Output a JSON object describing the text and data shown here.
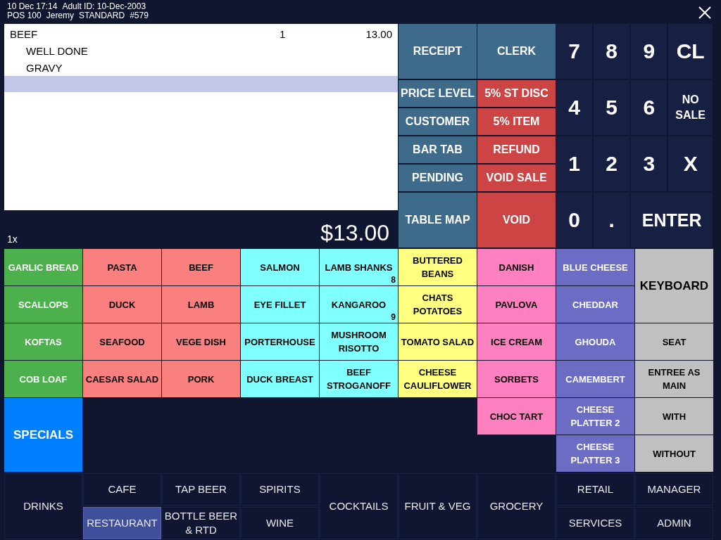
{
  "header": {
    "line_1": [
      "10 Dec 17:14",
      "Adult ID: 10-Dec-2003"
    ],
    "line_2": [
      "POS 100",
      "Jeremy",
      "STANDARD",
      "#579"
    ]
  },
  "order": {
    "lines": [
      {
        "name": "BEEF",
        "qty": "1",
        "price": "13.00",
        "children": [
          {
            "name": "WELL DONE"
          },
          {
            "name": "GRAVY"
          }
        ]
      }
    ],
    "input_line": {
      "selected": true
    },
    "quantity": "1x",
    "total": "$13.00"
  },
  "functions": [
    [
      {
        "label": "RECEIPT",
        "color": "#3f6b8a"
      },
      {
        "label": "CLERK",
        "color": "#3f6b8a"
      }
    ],
    [
      {
        "label": "PRICE LEVEL",
        "color": "#3f6b8a"
      },
      {
        "label": "5% ST DISC",
        "color": "#cc4444"
      }
    ],
    [
      {
        "label": "CUSTOMER",
        "color": "#3f6b8a"
      },
      {
        "label": "5% ITEM",
        "color": "#cc4444"
      }
    ],
    [
      {
        "label": "BAR TAB",
        "color": "#3f6b8a"
      },
      {
        "label": "REFUND",
        "color": "#cc4444"
      }
    ],
    [
      {
        "label": "PENDING",
        "color": "#3f6b8a"
      },
      {
        "label": "VOID SALE",
        "color": "#cc4444"
      }
    ],
    [
      {
        "label": "TABLE MAP",
        "color": "#3f6b8a"
      },
      {
        "label": "VOID",
        "color": "#cc4444"
      }
    ]
  ],
  "keypad": [
    {
      "label": "7",
      "kind": "key"
    },
    {
      "label": "8",
      "kind": "key"
    },
    {
      "label": "9",
      "kind": "key"
    },
    {
      "label": "CL",
      "kind": "key"
    },
    {
      "label": "4",
      "kind": "key"
    },
    {
      "label": "5",
      "kind": "key"
    },
    {
      "label": "6",
      "kind": "key"
    },
    {
      "label": "NO SALE",
      "kind": "small"
    },
    {
      "label": "1",
      "kind": "key"
    },
    {
      "label": "2",
      "kind": "key"
    },
    {
      "label": "3",
      "kind": "key"
    },
    {
      "label": "X",
      "kind": "key"
    },
    {
      "label": "0",
      "kind": "key"
    },
    {
      "label": ".",
      "kind": "key"
    },
    {
      "label": "ENTER",
      "kind": "wide"
    }
  ],
  "menu": [
    [
      {
        "label": "GARLIC BREAD",
        "color": "#4cb04c",
        "kind": "item"
      },
      {
        "label": "SCALLOPS",
        "color": "#4cb04c",
        "kind": "item"
      },
      {
        "label": "KOFTAS",
        "color": "#4cb04c",
        "kind": "item"
      },
      {
        "label": "COB LOAF",
        "color": "#4cb04c",
        "kind": "item"
      },
      {
        "label": "SPECIALS",
        "color": "#0080ff",
        "kind": "tall"
      }
    ],
    [
      {
        "label": "PASTA",
        "color": "#fa8080",
        "kind": "item"
      },
      {
        "label": "DUCK",
        "color": "#fa8080",
        "kind": "item"
      },
      {
        "label": "SEAFOOD",
        "color": "#fa8080",
        "kind": "item"
      },
      {
        "label": "CAESAR SALAD",
        "color": "#fa8080",
        "kind": "item"
      }
    ],
    [
      {
        "label": "BEEF",
        "color": "#fa8080",
        "kind": "item"
      },
      {
        "label": "LAMB",
        "color": "#fa8080",
        "kind": "item"
      },
      {
        "label": "VEGE DISH",
        "color": "#fa8080",
        "kind": "item"
      },
      {
        "label": "PORK",
        "color": "#fa8080",
        "kind": "item"
      }
    ],
    [
      {
        "label": "SALMON",
        "color": "#80ffff",
        "kind": "item"
      },
      {
        "label": "EYE FILLET",
        "color": "#80ffff",
        "kind": "item"
      },
      {
        "label": "PORTERHOUSE",
        "color": "#80ffff",
        "kind": "item"
      },
      {
        "label": "DUCK BREAST",
        "color": "#80ffff",
        "kind": "item"
      }
    ],
    [
      {
        "label": "LAMB SHANKS",
        "color": "#80ffff",
        "kind": "item",
        "badge": "8"
      },
      {
        "label": "KANGAROO",
        "color": "#80ffff",
        "kind": "item",
        "badge": "9"
      },
      {
        "label": "MUSHROOM RISOTTO",
        "color": "#80ffff",
        "kind": "item"
      },
      {
        "label": "BEEF STROGANOFF",
        "color": "#80ffff",
        "kind": "item"
      }
    ],
    [
      {
        "label": "BUTTERED BEANS",
        "color": "#ffff80",
        "kind": "item"
      },
      {
        "label": "CHATS POTATOES",
        "color": "#ffff80",
        "kind": "item"
      },
      {
        "label": "TOMATO SALAD",
        "color": "#ffff80",
        "kind": "item"
      },
      {
        "label": "CHEESE CAULIFLOWER",
        "color": "#ffff80",
        "kind": "item"
      }
    ],
    [
      {
        "label": "DANISH",
        "color": "#ff80c0",
        "kind": "item"
      },
      {
        "label": "PAVLOVA",
        "color": "#ff80c0",
        "kind": "item"
      },
      {
        "label": "ICE CREAM",
        "color": "#ff80c0",
        "kind": "item"
      },
      {
        "label": "SORBETS",
        "color": "#ff80c0",
        "kind": "item"
      },
      {
        "label": "CHOC TART",
        "color": "#ff80c0",
        "kind": "item"
      }
    ],
    [
      {
        "label": "BLUE CHEESE",
        "color": "#6c6cc4",
        "kind": "item"
      },
      {
        "label": "CHEDDAR",
        "color": "#6c6cc4",
        "kind": "item"
      },
      {
        "label": "GHOUDA",
        "color": "#6c6cc4",
        "kind": "item"
      },
      {
        "label": "CAMEMBERT",
        "color": "#6c6cc4",
        "kind": "item"
      },
      {
        "label": "CHEESE PLATTER 2",
        "color": "#6c6cc4",
        "kind": "item"
      },
      {
        "label": "CHEESE PLATTER 3",
        "color": "#6c6cc4",
        "kind": "item"
      }
    ],
    [
      {
        "label": "KEYBOARD",
        "color": "#c0c0c0",
        "kind": "tall"
      },
      {
        "label": "SEAT",
        "color": "#c0c0c0",
        "kind": "item"
      },
      {
        "label": "ENTREE AS MAIN",
        "color": "#c0c0c0",
        "kind": "item"
      },
      {
        "label": "WITH",
        "color": "#c0c0c0",
        "kind": "item"
      },
      {
        "label": "WITHOUT",
        "color": "#c0c0c0",
        "kind": "item"
      }
    ]
  ],
  "categories": [
    [
      {
        "label": "DRINKS",
        "selected": false
      }
    ],
    [
      {
        "label": "CAFE",
        "selected": false
      },
      {
        "label": "RESTAURANT",
        "selected": true
      }
    ],
    [
      {
        "label": "TAP BEER",
        "selected": false
      },
      {
        "label": "BOTTLE BEER & RTD",
        "selected": false
      }
    ],
    [
      {
        "label": "SPIRITS",
        "selected": false
      },
      {
        "label": "WINE",
        "selected": false
      }
    ],
    [
      {
        "label": "COCKTAILS",
        "selected": false
      }
    ],
    [
      {
        "label": "FRUIT & VEG",
        "selected": false
      }
    ],
    [
      {
        "label": "GROCERY",
        "selected": false
      }
    ],
    [
      {
        "label": "RETAIL",
        "selected": false
      },
      {
        "label": "SERVICES",
        "selected": false
      }
    ],
    [
      {
        "label": "MANAGER",
        "selected": false
      },
      {
        "label": "ADMIN",
        "selected": false
      }
    ]
  ]
}
